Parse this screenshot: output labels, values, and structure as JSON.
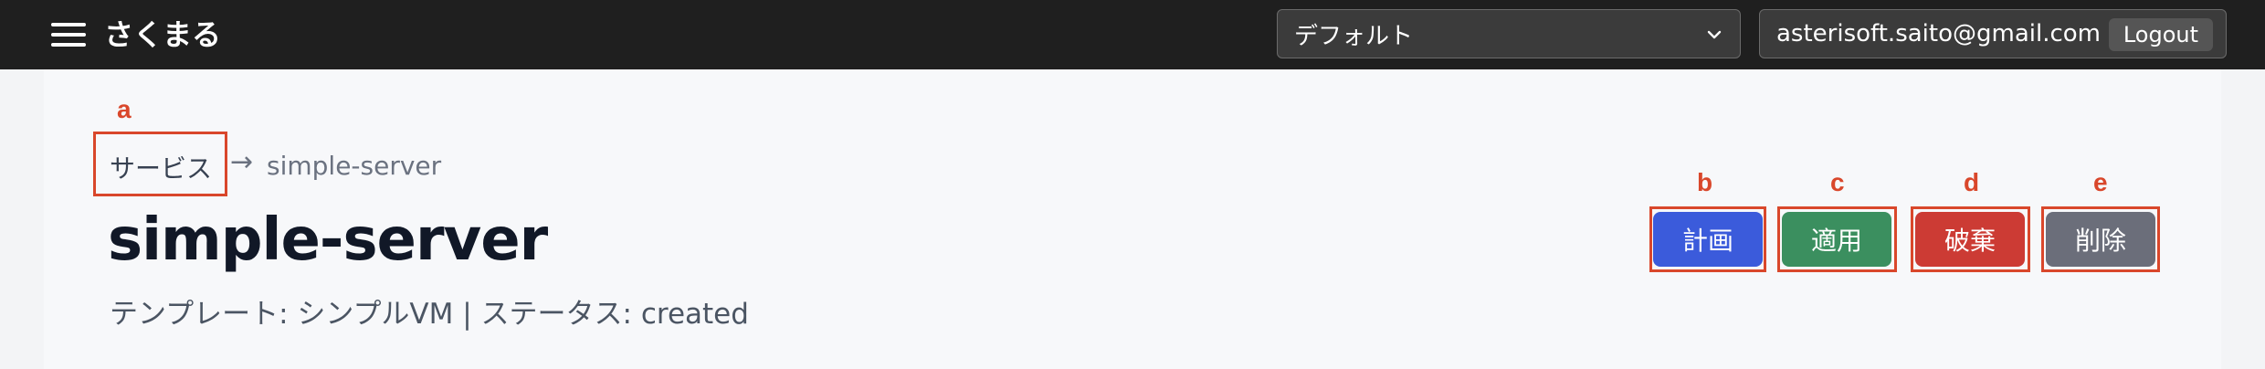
{
  "header": {
    "app_title": "さくまる",
    "workspace_select": {
      "selected": "デフォルト"
    },
    "user": {
      "email": "asterisoft.saito@gmail.com",
      "logout_label": "Logout"
    }
  },
  "breadcrumb": {
    "parent": "サービス",
    "separator": "→",
    "current": "simple-server"
  },
  "page": {
    "title": "simple-server",
    "meta": "テンプレート: シンプルVM | ステータス: created"
  },
  "actions": {
    "plan_label": "計画",
    "apply_label": "適用",
    "destroy_label": "破棄",
    "delete_label": "削除"
  },
  "annotations": {
    "a": "a",
    "b": "b",
    "c": "c",
    "d": "d",
    "e": "e"
  },
  "colors": {
    "topbar_bg": "#1f1f1f",
    "annotation_red": "#d9472b",
    "plan_blue": "#3b5bdb",
    "apply_green": "#3b8f5f",
    "destroy_red": "#cc3b34",
    "delete_gray": "#6b6e7a"
  },
  "icons": {
    "menu": "hamburger-menu-icon",
    "select_chevron": "chevron-down-icon"
  }
}
